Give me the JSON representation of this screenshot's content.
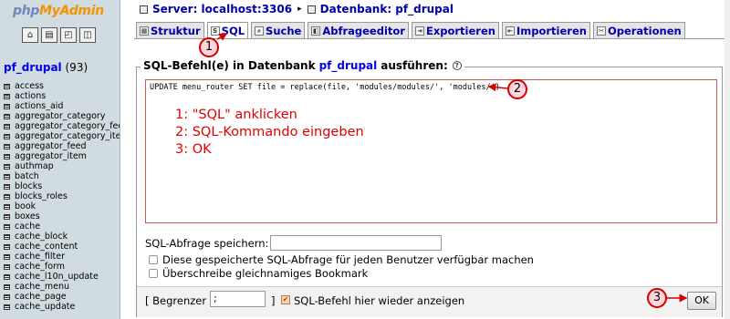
{
  "logo": {
    "part1": "php",
    "part2": "My",
    "part3": "Admin"
  },
  "nav_icons": [
    "home-icon",
    "sql-icon",
    "query-window-icon",
    "docs-icon"
  ],
  "database": {
    "name": "pf_drupal",
    "count": "(93)"
  },
  "tables": [
    "access",
    "actions",
    "actions_aid",
    "aggregator_category",
    "aggregator_category_fee",
    "aggregator_category_iter",
    "aggregator_feed",
    "aggregator_item",
    "authmap",
    "batch",
    "blocks",
    "blocks_roles",
    "book",
    "boxes",
    "cache",
    "cache_block",
    "cache_content",
    "cache_filter",
    "cache_form",
    "cache_l10n_update",
    "cache_menu",
    "cache_page",
    "cache_update"
  ],
  "breadcrumb": {
    "server_label": "Server: localhost:3306",
    "separator": "▸",
    "db_label": "Datenbank: pf_drupal"
  },
  "tabs": [
    {
      "label": "Struktur",
      "icon": "structure-icon"
    },
    {
      "label": "SQL",
      "icon": "sql-icon"
    },
    {
      "label": "Suche",
      "icon": "search-icon"
    },
    {
      "label": "Abfrageeditor",
      "icon": "query-icon"
    },
    {
      "label": "Exportieren",
      "icon": "export-icon"
    },
    {
      "label": "Importieren",
      "icon": "import-icon"
    },
    {
      "label": "Operationen",
      "icon": "operations-icon"
    }
  ],
  "form": {
    "legend_prefix": "SQL-Befehl(e) in Datenbank",
    "legend_db": "pf_drupal",
    "legend_suffix": "ausführen:",
    "sql_query": "UPDATE menu_router SET file = replace(file, 'modules/modules/', 'modules/')",
    "save_label": "SQL-Abfrage speichern:",
    "save_value": "",
    "share_label": "Diese gespeicherte SQL-Abfrage für jeden Benutzer verfügbar machen",
    "overwrite_label": "Überschreibe gleichnamiges Bookmark",
    "delimiter_label_open": "[ Begrenzer",
    "delimiter_value": ";",
    "delimiter_label_close": "]",
    "show_again_label": "SQL-Befehl hier wieder anzeigen",
    "ok_label": "OK"
  },
  "instructions": [
    "1: \"SQL\" anklicken",
    "2: SQL-Kommando eingeben",
    "3: OK"
  ],
  "markers": [
    "1",
    "2",
    "3"
  ],
  "colors": {
    "link": "#0000ee",
    "annotation": "#e00000",
    "nav_bg": "#d0dce0"
  }
}
